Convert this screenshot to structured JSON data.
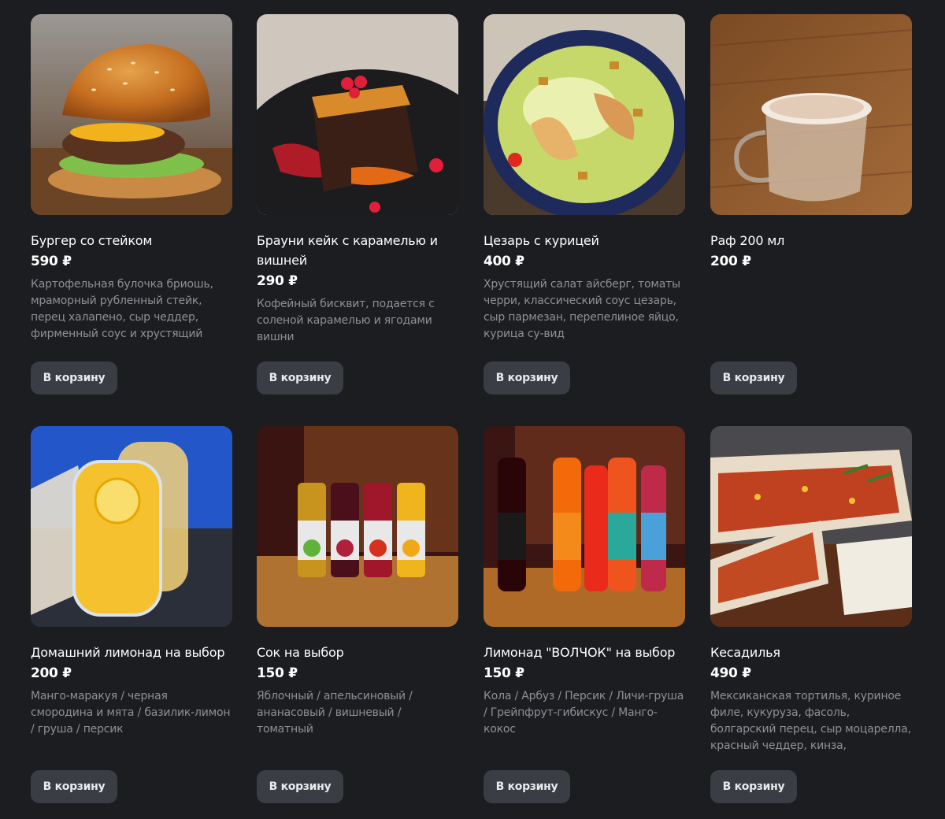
{
  "currency": "₽",
  "add_to_cart_label": "В корзину",
  "items": [
    {
      "title": "Бургер со стейком",
      "price": "590 ₽",
      "description": "Картофельная булочка бриошь, мраморный рубленный стейк, перец халапено, сыр чеддер, фирменный соус и хрустящий салат айсберг",
      "photo": "burger"
    },
    {
      "title": "Брауни кейк с карамелью и вишней",
      "price": "290 ₽",
      "description": "Кофейный бисквит, подается с соленой карамелью и ягодами вишни",
      "photo": "brownie"
    },
    {
      "title": "Цезарь с курицей",
      "price": "400 ₽",
      "description": "Хрустящий салат айсберг, томаты черри, классический соус цезарь, сыр пармезан, перепелиное яйцо, курица су-вид",
      "photo": "caesar"
    },
    {
      "title": "Раф 200 мл",
      "price": "200 ₽",
      "description": "",
      "photo": "raf"
    },
    {
      "title": "Домашний лимонад на выбор",
      "price": "200 ₽",
      "description": "Манго-маракуя / черная смородина и мята / базилик-лимон / груша / персик",
      "photo": "lemonade"
    },
    {
      "title": "Сок на выбор",
      "price": "150 ₽",
      "description": "Яблочный / апельсиновый / ананасовый / вишневый / томатный",
      "photo": "juice"
    },
    {
      "title": "Лимонад \"ВОЛЧОК\" на выбор",
      "price": "150 ₽",
      "description": "Кола / Арбуз / Персик / Личи-груша / Грейпфрут-гибискус / Манго-кокос",
      "photo": "volchok"
    },
    {
      "title": "Кесадилья",
      "price": "490 ₽",
      "description": "Мексиканская тортилья, куриное филе, кукуруза, фасоль, болгарский перец, сыр моцарелла, красный чеддер, кинза, фирменная Holy...",
      "photo": "quesadilla"
    }
  ],
  "colors": {
    "background": "#1c1d20",
    "button_bg": "#3b3d44",
    "text_primary": "#ffffff",
    "text_secondary": "#8f9096"
  }
}
